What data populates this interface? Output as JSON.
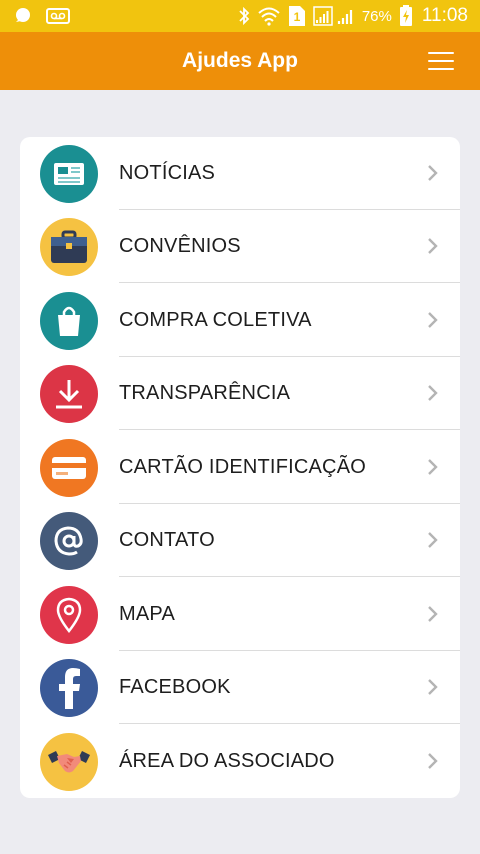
{
  "status_bar": {
    "battery_percent": "76%",
    "time": "11:08",
    "sim_badge": "1",
    "icons": [
      "notification-icon",
      "voicemail-icon",
      "bluetooth-icon",
      "wifi-icon",
      "sim-icon",
      "signal-icon",
      "battery-charging-icon"
    ]
  },
  "app_bar": {
    "title": "Ajudes App",
    "menu_icon": "hamburger-menu-icon",
    "color": "#ee8f09"
  },
  "colors": {
    "status_bar": "#f1c40f",
    "background": "#ececf1",
    "card": "#ffffff"
  },
  "menu": {
    "items": [
      {
        "label": "NOTÍCIAS",
        "icon": "newspaper-icon",
        "icon_bg": "#1a8f92"
      },
      {
        "label": "CONVÊNIOS",
        "icon": "briefcase-icon",
        "icon_bg": "#f5c242"
      },
      {
        "label": "COMPRA COLETIVA",
        "icon": "shopping-bag-icon",
        "icon_bg": "#1a8f92"
      },
      {
        "label": "TRANSPARÊNCIA",
        "icon": "download-icon",
        "icon_bg": "#dc3546"
      },
      {
        "label": "CARTÃO IDENTIFICAÇÃO",
        "icon": "card-icon",
        "icon_bg": "#f07722"
      },
      {
        "label": "CONTATO",
        "icon": "at-sign-icon",
        "icon_bg": "#445a7a"
      },
      {
        "label": "MAPA",
        "icon": "map-pin-icon",
        "icon_bg": "#e0354a"
      },
      {
        "label": "FACEBOOK",
        "icon": "facebook-icon",
        "icon_bg": "#3a5a98"
      },
      {
        "label": "ÁREA DO ASSOCIADO",
        "icon": "handshake-icon",
        "icon_bg": "#f5c242"
      }
    ]
  }
}
